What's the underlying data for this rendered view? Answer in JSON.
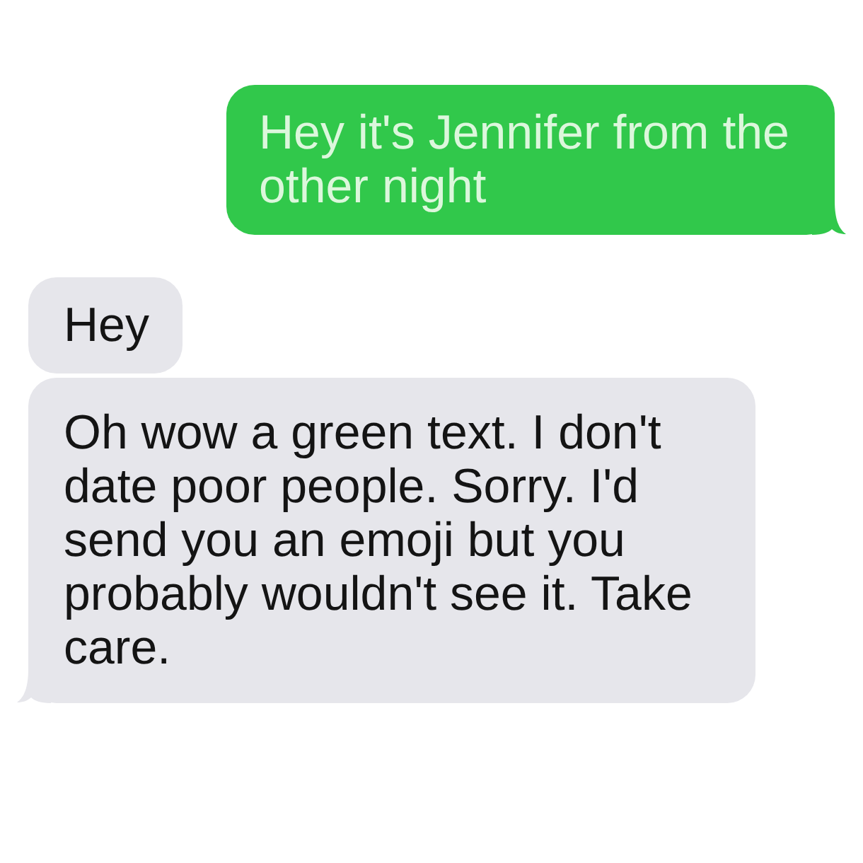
{
  "messages": [
    {
      "kind": "sent",
      "text": "Hey it's Jennifer from the other night",
      "tail": true
    },
    {
      "kind": "received",
      "text": "Hey",
      "tail": false
    },
    {
      "kind": "received",
      "text": "Oh wow a green text. I don't date poor people. Sorry. I'd send you an emoji but you probably wouldn't see it. Take care.",
      "tail": true
    }
  ]
}
